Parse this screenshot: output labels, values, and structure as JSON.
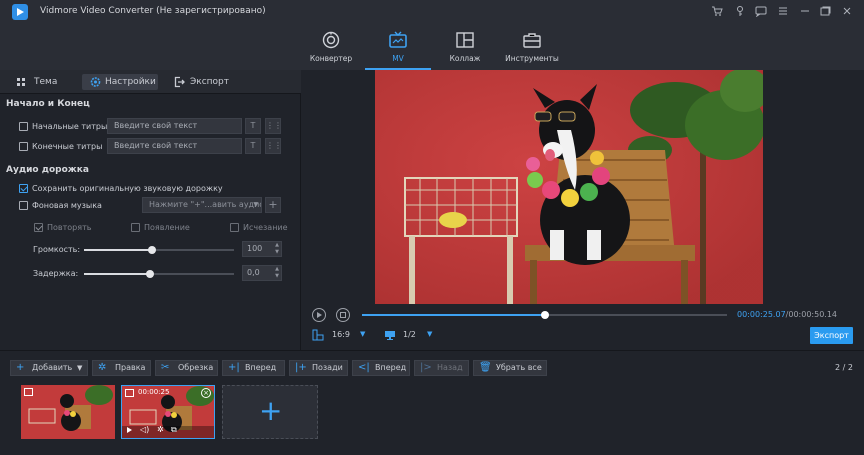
{
  "app": {
    "title": "Vidmore Video Converter (Не зарегистрировано)"
  },
  "nav": [
    {
      "label": "Конвертер",
      "icon": "play-circle-icon"
    },
    {
      "label": "MV",
      "icon": "tv-icon"
    },
    {
      "label": "Коллаж",
      "icon": "collage-icon"
    },
    {
      "label": "Инструменты",
      "icon": "toolbox-icon"
    }
  ],
  "subtabs": {
    "theme": "Тема",
    "settings": "Настройки",
    "export": "Экспорт"
  },
  "start_end": {
    "title": "Начало и Конец",
    "start_label": "Начальные титры",
    "start_placeholder": "Введите свой текст",
    "end_label": "Конечные титры",
    "end_placeholder": "Введите свой текст"
  },
  "audio": {
    "title": "Аудио дорожка",
    "keep_original": "Сохранить оригинальную звуковую дорожку",
    "bg_music": "Фоновая музыка",
    "bg_music_select": "Нажмите \"+\"...авить аудио",
    "loop": "Повторять",
    "fade_in": "Появление",
    "fade_out": "Исчезание",
    "volume_label": "Громкость:",
    "volume_value": "100",
    "volume_level": 0.45,
    "delay_label": "Задержка:",
    "delay_value": "0,0",
    "delay_level": 0.44
  },
  "player": {
    "current_time": "00:00:25.07",
    "total_time": "/00:00:50.14",
    "progress": 0.5,
    "aspect": "16:9",
    "screen": "1/2",
    "export_label": "Экспорт"
  },
  "toolbar": {
    "add": "Добавить",
    "edit": "Правка",
    "trim": "Обрезка",
    "forward": "Вперед",
    "backward": "Позади",
    "ahead": "Вперед",
    "back": "Назад",
    "remove_all": "Убрать все",
    "page": "2 / 2"
  },
  "clips": [
    {
      "duration": ""
    },
    {
      "duration": "00:00:25"
    }
  ],
  "colors": {
    "accent": "#3ea2f2",
    "video_bg": "#c43a3a"
  }
}
